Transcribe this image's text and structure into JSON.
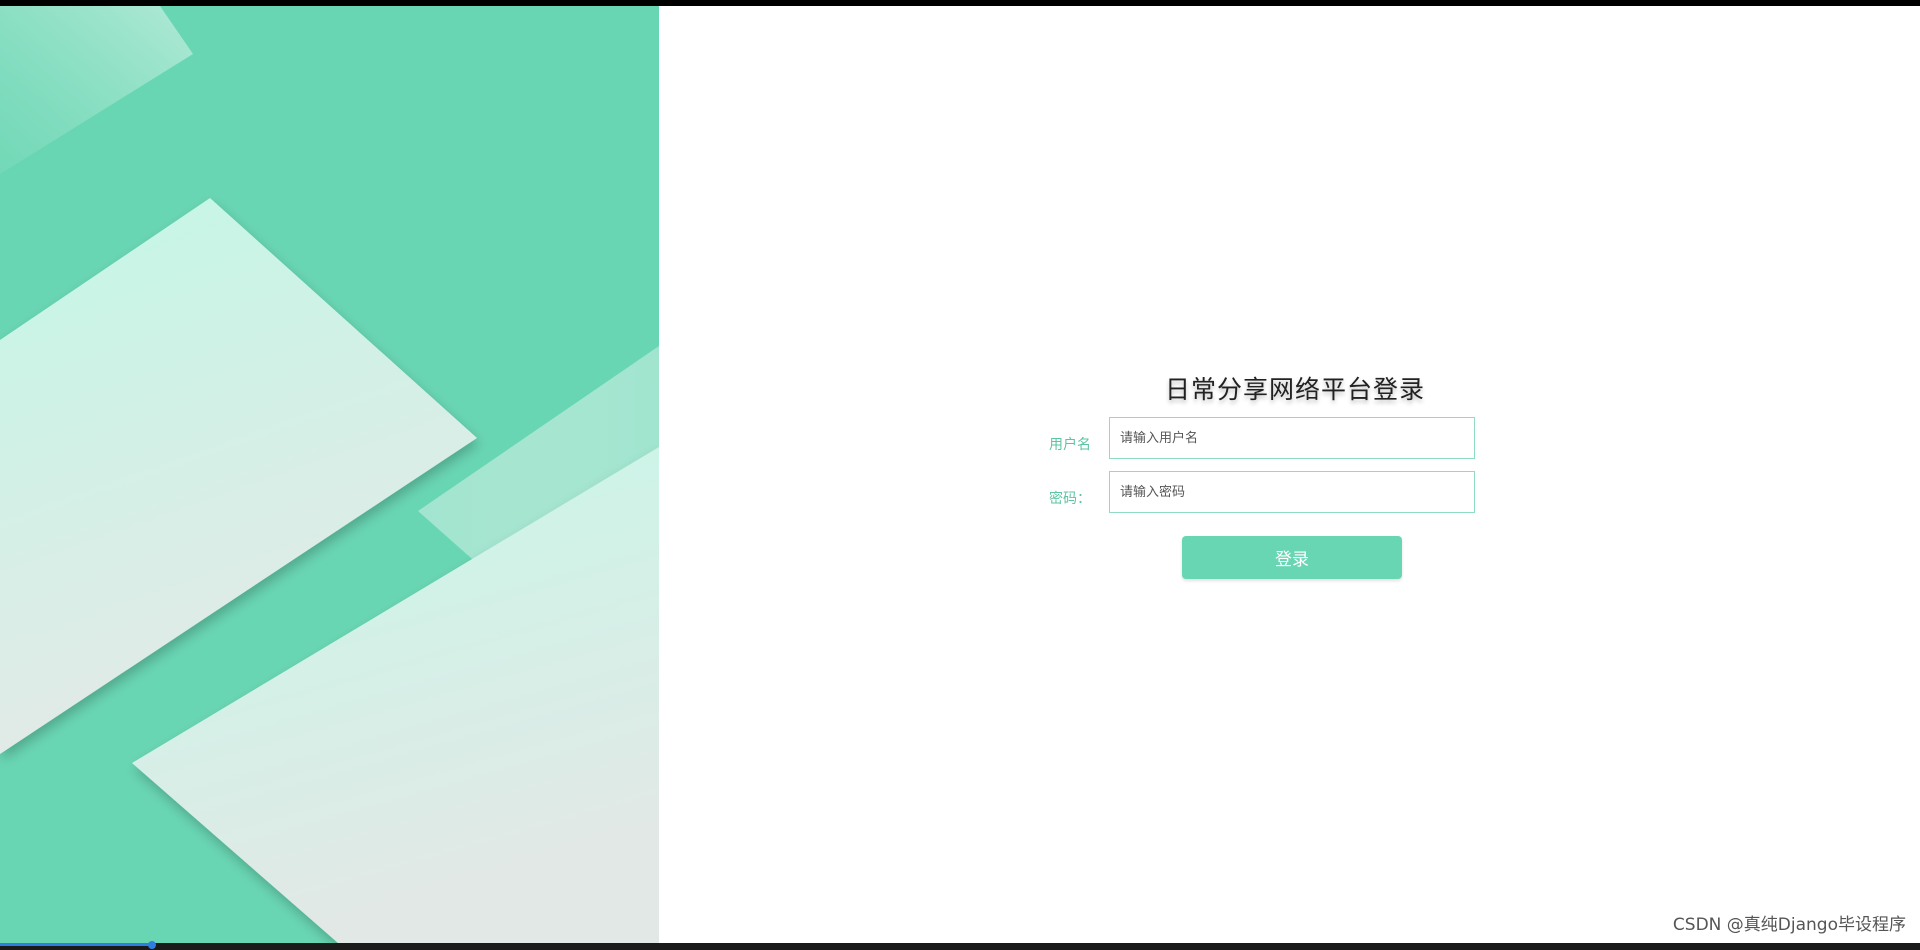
{
  "login": {
    "title": "日常分享网络平台登录",
    "username_label": "用户名",
    "username_placeholder": "请输入用户名",
    "password_label": "密码：",
    "password_placeholder": "请输入密码",
    "submit_label": "登录"
  },
  "watermark": "CSDN @真纯Django毕设程序",
  "colors": {
    "accent": "#69d6b3",
    "label": "#5cc5a2",
    "input_border": "#8fdcc3"
  }
}
